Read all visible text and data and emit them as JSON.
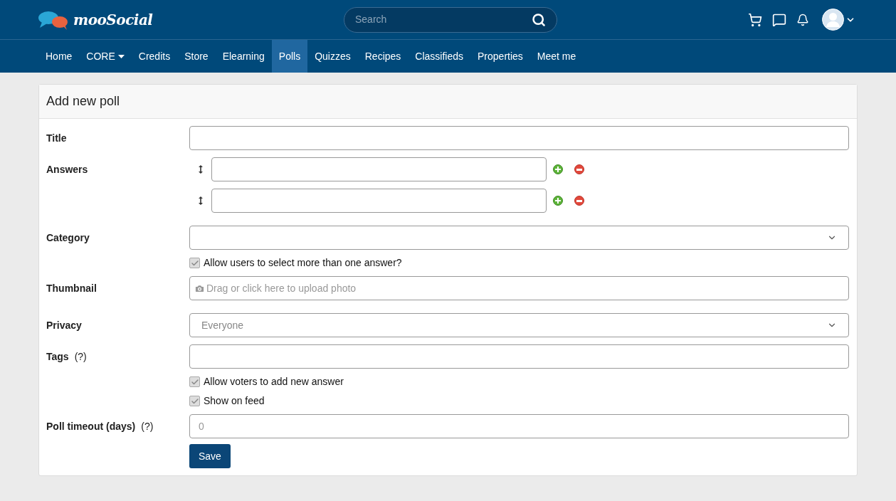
{
  "header": {
    "logo": "mooSocial",
    "search": {
      "placeholder": "Search"
    }
  },
  "nav": [
    {
      "label": "Home",
      "selected": false,
      "dropdown": false
    },
    {
      "label": "CORE",
      "selected": false,
      "dropdown": true
    },
    {
      "label": "Credits",
      "selected": false,
      "dropdown": false
    },
    {
      "label": "Store",
      "selected": false,
      "dropdown": false
    },
    {
      "label": "Elearning",
      "selected": false,
      "dropdown": false
    },
    {
      "label": "Polls",
      "selected": true,
      "dropdown": false
    },
    {
      "label": "Quizzes",
      "selected": false,
      "dropdown": false
    },
    {
      "label": "Recipes",
      "selected": false,
      "dropdown": false
    },
    {
      "label": "Classifieds",
      "selected": false,
      "dropdown": false
    },
    {
      "label": "Properties",
      "selected": false,
      "dropdown": false
    },
    {
      "label": "Meet me",
      "selected": false,
      "dropdown": false
    }
  ],
  "form": {
    "title": "Add new poll",
    "rows": [
      {
        "kind": "text",
        "label": "Title"
      },
      {
        "kind": "answers",
        "label": "Answers",
        "answers": [
          {
            "kind": "blank"
          },
          {
            "kind": "blank"
          }
        ]
      },
      {
        "kind": "select",
        "label": "Category"
      },
      {
        "kind": "checkbox",
        "text": "Allow users to select more than one answer?",
        "checked": true
      },
      {
        "kind": "upload",
        "label": "Thumbnail",
        "placeholder": "Drag or click here to upload photo"
      },
      {
        "kind": "select",
        "label": "Privacy",
        "value": "Everyone"
      },
      {
        "kind": "text",
        "label": "Tags",
        "help": "(?)"
      },
      {
        "kind": "checkbox",
        "text": "Allow voters to add new answer",
        "checked": true
      },
      {
        "kind": "checkbox",
        "text": "Show on feed",
        "checked": true
      },
      {
        "kind": "text",
        "label": "Poll timeout (days)",
        "help": "(?)",
        "placeholder": "0"
      },
      {
        "kind": "save",
        "text": "Save"
      }
    ]
  }
}
